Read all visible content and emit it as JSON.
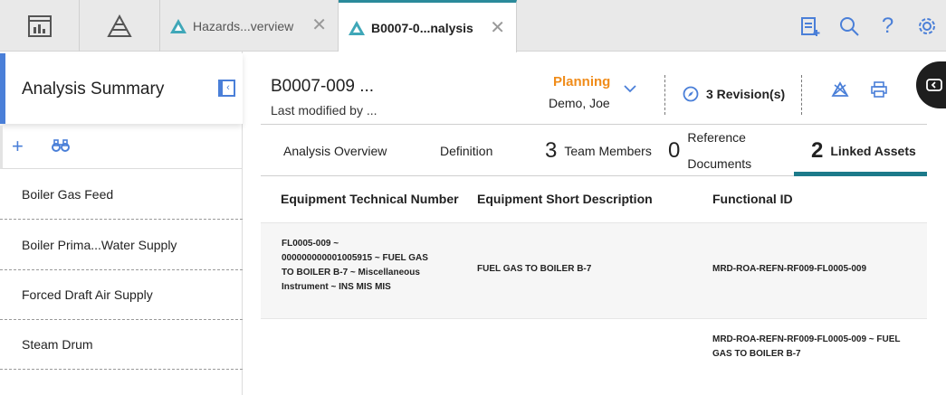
{
  "top_tabs": {
    "home_icon": "dashboard-icon",
    "tree_icon": "asset-tree-icon",
    "tab1": {
      "label": "Hazards...verview",
      "icon": "hazards-analysis-icon",
      "close": "✕"
    },
    "tab2": {
      "label": "B0007-0...nalysis",
      "icon": "hazards-analysis-icon",
      "close": "✕"
    },
    "right_icons": [
      "clipboard-add-icon",
      "search-icon",
      "help-icon",
      "gear-icon"
    ],
    "help_glyph": "?"
  },
  "left_panel": {
    "title": "Analysis Summary",
    "collapse_glyph": "‹",
    "add_glyph": "+",
    "items": [
      {
        "label": "Boiler Gas Feed"
      },
      {
        "label": "Boiler Prima...Water Supply"
      },
      {
        "label": "Forced Draft Air Supply"
      },
      {
        "label": "Steam Drum"
      }
    ]
  },
  "header": {
    "title": "B0007-009 ...",
    "subtitle": "Last modified by ...",
    "state": "Planning",
    "state_user": "Demo, Joe",
    "revisions": "3 Revision(s)"
  },
  "subtabs": [
    {
      "count": "",
      "label": "Analysis Overview"
    },
    {
      "count": "",
      "label": "Definition"
    },
    {
      "count": "3",
      "label": "Team Members"
    },
    {
      "count": "0",
      "label": "Reference",
      "label2": "Documents"
    },
    {
      "count": "2",
      "label": "Linked Assets"
    }
  ],
  "table": {
    "columns": [
      "Equipment Technical Number",
      "Equipment Short Description",
      "Functional ID"
    ],
    "rows": [
      {
        "tech_number": [
          "FL0005-009 ~",
          "000000000001005915 ~ FUEL GAS",
          "TO BOILER B-7 ~ Miscellaneous",
          "Instrument ~ INS MIS MIS"
        ],
        "short_description": "FUEL GAS TO BOILER B-7",
        "functional_id": "MRD-ROA-REFN-RF009-FL0005-009"
      },
      {
        "tech_number": [],
        "short_description": "",
        "functional_id": [
          "MRD-ROA-REFN-RF009-FL0005-009 ~ FUEL",
          "GAS TO BOILER B-7"
        ]
      }
    ]
  },
  "colors": {
    "accent_blue": "#4a7fd8",
    "teal": "#1c7a8a",
    "planning_orange": "#f08c1a"
  }
}
